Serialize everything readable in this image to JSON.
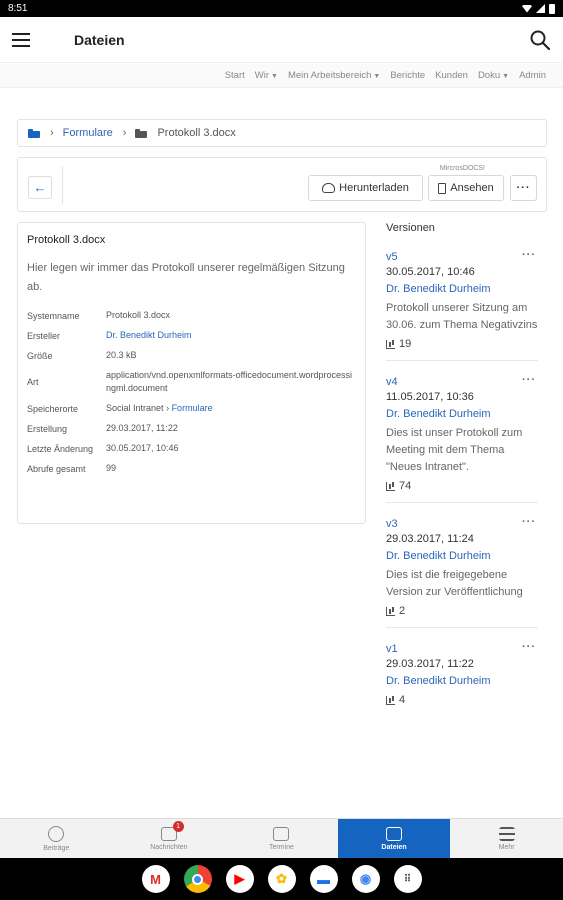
{
  "status_bar": {
    "time": "8:51"
  },
  "app_bar": {
    "title": "Dateien"
  },
  "top_nav": {
    "items": [
      "Start",
      "Wir",
      "Mein Arbeitsbereich",
      "Berichte",
      "Kunden",
      "Doku",
      "Admin"
    ]
  },
  "breadcrumb": {
    "parent": "Formulare",
    "current": "Protokoll 3.docx"
  },
  "toolbar": {
    "ms_label": "MircrosDOCS!",
    "download_label": "Herunterladen",
    "view_label": "Ansehen",
    "more_label": "···"
  },
  "file": {
    "title": "Protokoll 3.docx",
    "description": "Hier legen wir immer das Protokoll unserer regelmäßigen Sitzung ab.",
    "props": {
      "system_name_label": "Systemname",
      "system_name": "Protokoll 3.docx",
      "creator_label": "Ersteller",
      "creator": "Dr. Benedikt Durheim",
      "size_label": "Größe",
      "size": "20.3 kB",
      "type_label": "Art",
      "type": "application/vnd.openxmlformats-officedocument.wordprocessingml.document",
      "location_label": "Speicherorte",
      "location_root": "Social Intranet",
      "location_folder": "Formulare",
      "created_label": "Erstellung",
      "created": "29.03.2017, 11:22",
      "modified_label": "Letzte Änderung",
      "modified": "30.05.2017, 10:46",
      "views_label": "Abrufe gesamt",
      "views": "99"
    }
  },
  "versions": {
    "title": "Versionen",
    "items": [
      {
        "name": "v5",
        "date": "30.05.2017, 10:46",
        "author": "Dr. Benedikt Durheim",
        "comment": "Protokoll unserer Sitzung am 30.06. zum Thema Negativzins",
        "views": "19"
      },
      {
        "name": "v4",
        "date": "11.05.2017, 10:36",
        "author": "Dr. Benedikt Durheim",
        "comment": "Dies ist unser Protokoll zum Meeting mit dem Thema \"Neues Intranet\".",
        "views": "74"
      },
      {
        "name": "v3",
        "date": "29.03.2017, 11:24",
        "author": "Dr. Benedikt Durheim",
        "comment": "Dies ist die freigegebene Version zur Veröffentlichung",
        "views": "2"
      },
      {
        "name": "v1",
        "date": "29.03.2017, 11:22",
        "author": "Dr. Benedikt Durheim",
        "comment": "",
        "views": "4"
      }
    ]
  },
  "bottom_nav": {
    "items": [
      "Beiträge",
      "Nachrichten",
      "Termine",
      "Dateien",
      "Mehr"
    ],
    "badge": "1"
  },
  "colors": {
    "accent": "#1565c0",
    "link": "#2b66b8",
    "badge": "#d32f2f"
  }
}
